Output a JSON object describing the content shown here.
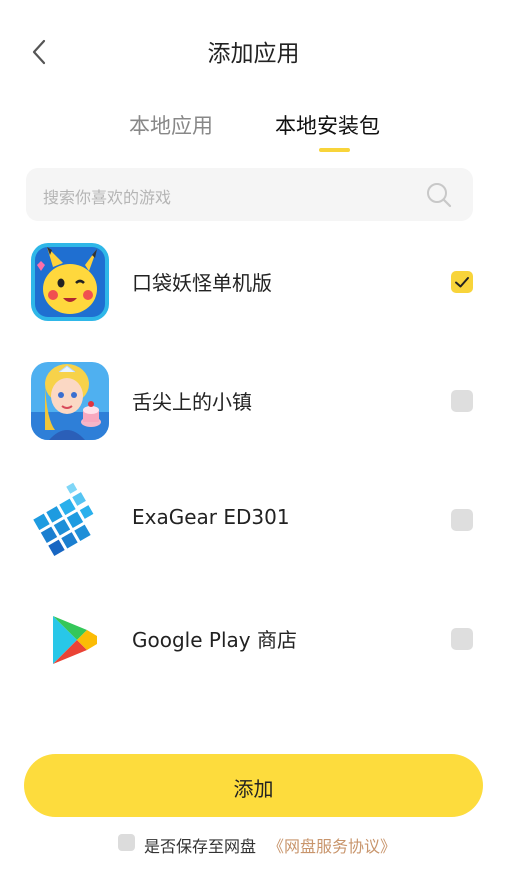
{
  "header": {
    "title": "添加应用",
    "back_icon": "back-chevron-icon"
  },
  "tabs": [
    {
      "label": "本地应用",
      "active": false
    },
    {
      "label": "本地安装包",
      "active": true
    }
  ],
  "search": {
    "placeholder": "搜索你喜欢的游戏",
    "icon": "search-icon"
  },
  "apps": [
    {
      "name": "口袋妖怪单机版",
      "checked": true,
      "icon": "pikachu-app-icon"
    },
    {
      "name": "舌尖上的小镇",
      "checked": false,
      "icon": "cake-girl-app-icon"
    },
    {
      "name": "ExaGear ED301",
      "checked": false,
      "icon": "exagear-app-icon"
    },
    {
      "name": "Google Play 商店",
      "checked": false,
      "icon": "google-play-icon"
    }
  ],
  "footer": {
    "add_label": "添加",
    "save_label": "是否保存至网盘",
    "agreement_label": "《网盘服务协议》",
    "save_checked": false
  },
  "colors": {
    "accent": "#fddc3d",
    "link": "#c8956c",
    "checkbox_off": "#dedede"
  }
}
